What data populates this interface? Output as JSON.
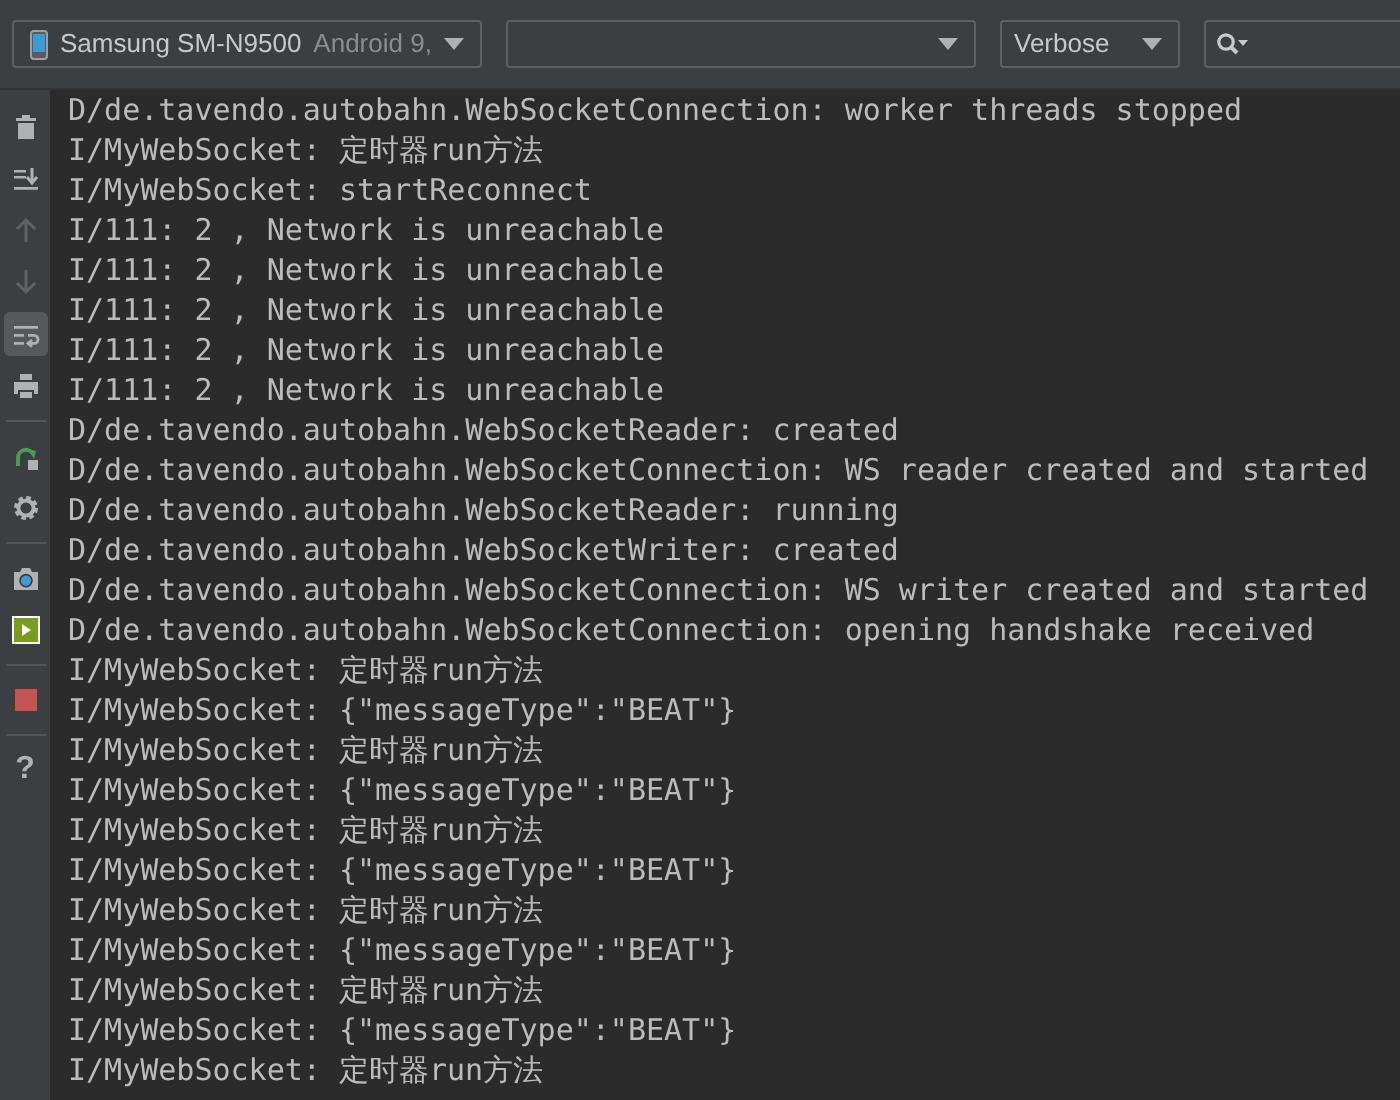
{
  "toolbar": {
    "device": {
      "name": "Samsung SM-N9500",
      "detail": "Android 9,"
    },
    "log_level": "Verbose"
  },
  "sidebar": [
    {
      "kind": "clear",
      "selected": false,
      "disabled": false
    },
    {
      "kind": "scroll-end",
      "selected": false,
      "disabled": false
    },
    {
      "kind": "up",
      "selected": false,
      "disabled": true
    },
    {
      "kind": "down",
      "selected": false,
      "disabled": true
    },
    {
      "kind": "wrap",
      "selected": true,
      "disabled": false
    },
    {
      "kind": "print",
      "selected": false,
      "disabled": false
    },
    {
      "kind": "restart",
      "selected": false,
      "disabled": false
    },
    {
      "kind": "settings",
      "selected": false,
      "disabled": false
    },
    {
      "kind": "camera",
      "selected": false,
      "disabled": false
    },
    {
      "kind": "record",
      "selected": false,
      "disabled": false
    },
    {
      "kind": "stop",
      "selected": false,
      "disabled": false
    },
    {
      "kind": "help",
      "label": "?",
      "selected": false,
      "disabled": false
    }
  ],
  "log_lines": [
    "D/de.tavendo.autobahn.WebSocketConnection: worker threads stopped",
    "I/MyWebSocket: 定时器run方法",
    "I/MyWebSocket: startReconnect",
    "I/111: 2 , Network is unreachable",
    "I/111: 2 , Network is unreachable",
    "I/111: 2 , Network is unreachable",
    "I/111: 2 , Network is unreachable",
    "I/111: 2 , Network is unreachable",
    "D/de.tavendo.autobahn.WebSocketReader: created",
    "D/de.tavendo.autobahn.WebSocketConnection: WS reader created and started",
    "D/de.tavendo.autobahn.WebSocketReader: running",
    "D/de.tavendo.autobahn.WebSocketWriter: created",
    "D/de.tavendo.autobahn.WebSocketConnection: WS writer created and started",
    "D/de.tavendo.autobahn.WebSocketConnection: opening handshake received",
    "I/MyWebSocket: 定时器run方法",
    "I/MyWebSocket: {\"messageType\":\"BEAT\"}",
    "I/MyWebSocket: 定时器run方法",
    "I/MyWebSocket: {\"messageType\":\"BEAT\"}",
    "I/MyWebSocket: 定时器run方法",
    "I/MyWebSocket: {\"messageType\":\"BEAT\"}",
    "I/MyWebSocket: 定时器run方法",
    "I/MyWebSocket: {\"messageType\":\"BEAT\"}",
    "I/MyWebSocket: 定时器run方法",
    "I/MyWebSocket: {\"messageType\":\"BEAT\"}",
    "I/MyWebSocket: 定时器run方法"
  ]
}
